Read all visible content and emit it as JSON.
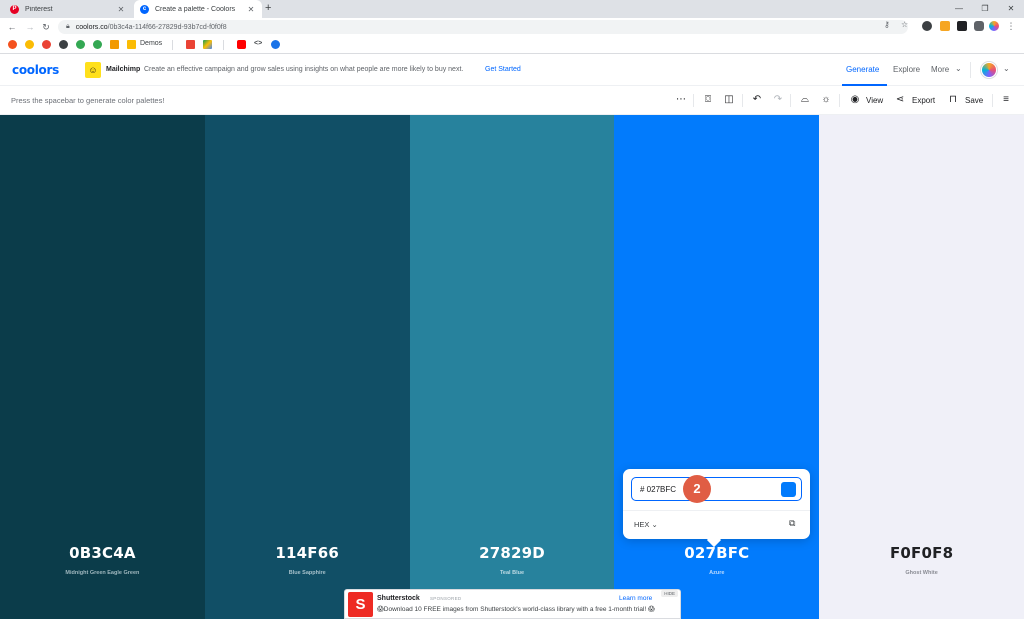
{
  "browser": {
    "tabs": [
      {
        "title": "Pinterest",
        "favicon": "pinterest-icon",
        "color": "#e60023"
      },
      {
        "title": "Create a palette - Coolors",
        "favicon": "coolors-icon",
        "color": "#0066ff"
      }
    ],
    "url": {
      "domain": "coolors.co",
      "path": "/0b3c4a-114f66-27829d-93b7cd-f0f0f8"
    },
    "bookmarks": [
      {
        "label": "Demos",
        "icon": "folder-icon"
      }
    ]
  },
  "header": {
    "logo": "coolors",
    "ad_brand": "Mailchimp",
    "ad_text": "Create an effective campaign and grow sales using insights on what people are more likely to buy next.",
    "ad_cta": "Get Started",
    "nav": {
      "generate": "Generate",
      "explore": "Explore",
      "more": "More"
    }
  },
  "toolbar": {
    "hint": "Press the spacebar to generate color palettes!",
    "view_label": "View",
    "export_label": "Export",
    "save_label": "Save"
  },
  "palette": [
    {
      "hex": "0B3C4A",
      "name": "Midnight Green Eagle Green",
      "color": "#0b3c4a",
      "text_color": "#ffffff",
      "sub_color": "#9fb7be"
    },
    {
      "hex": "114F66",
      "name": "Blue Sapphire",
      "color": "#114f66",
      "text_color": "#ffffff",
      "sub_color": "#a6c0ca"
    },
    {
      "hex": "27829D",
      "name": "Teal Blue",
      "color": "#27829d",
      "text_color": "#ffffff",
      "sub_color": "#bfdbe4"
    },
    {
      "hex": "027BFC",
      "name": "Azure",
      "color": "#027bfc",
      "text_color": "#ffffff",
      "sub_color": "#b9d9fe"
    },
    {
      "hex": "F0F0F8",
      "name": "Ghost White",
      "color": "#f0f0f8",
      "text_color": "#202124",
      "sub_color": "#8a8c94"
    }
  ],
  "picker": {
    "value": "# 027BFC",
    "format": "HEX",
    "swatch_color": "#027bfc",
    "step_number": "2"
  },
  "bottom_ad": {
    "brand": "Shutterstock",
    "sponsored": "SPONSORED",
    "text": "Download 10 FREE images from Shutterstock's world-class library with a free 1-month trial!",
    "cta": "Learn more",
    "hide": "HIDE"
  }
}
